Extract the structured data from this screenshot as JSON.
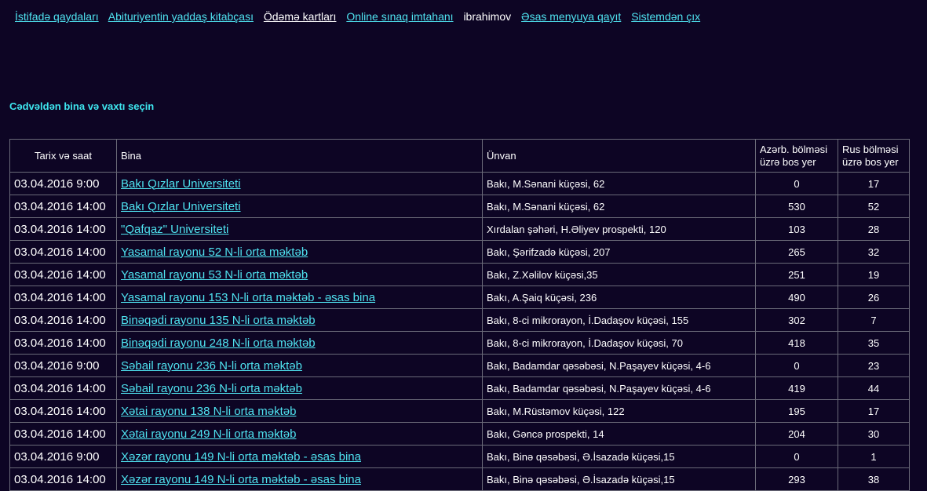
{
  "nav": {
    "items": [
      {
        "label": "İstifadə qaydaları",
        "style": "cyan"
      },
      {
        "label": "Abituriyentin yaddaş kitabçası",
        "style": "cyan"
      },
      {
        "label": "Ödəmə kartları",
        "style": "white"
      },
      {
        "label": "Online sınaq imtahanı",
        "style": "cyan"
      }
    ],
    "username": "ibrahimov",
    "main_menu": "Əsas menyuya qayıt",
    "logout": "Sistemdən çıx"
  },
  "heading": "Cədvəldən bina və vaxtı seçin",
  "table": {
    "headers": {
      "date": "Tarix və saat",
      "building": "Bina",
      "address": "Ünvan",
      "az_seats": "Azərb. bölməsi üzrə bos yer",
      "ru_seats": "Rus bölməsi üzrə bos yer"
    },
    "rows": [
      {
        "date": "03.04.2016 9:00",
        "building": "Bakı Qızlar Universiteti",
        "address": "Bakı, M.Sənani küçəsi, 62",
        "az": "0",
        "ru": "17"
      },
      {
        "date": "03.04.2016 14:00",
        "building": "Bakı Qızlar Universiteti",
        "address": "Bakı, M.Sənani küçəsi, 62",
        "az": "530",
        "ru": "52"
      },
      {
        "date": "03.04.2016 14:00",
        "building": "\"Qafqaz\" Universiteti",
        "address": "Xırdalan şəhəri, H.Əliyev prospekti, 120",
        "az": "103",
        "ru": "28"
      },
      {
        "date": "03.04.2016 14:00",
        "building": "Yasamal rayonu 52 N-li orta məktəb",
        "address": "Bakı, Şərifzadə küçəsi, 207",
        "az": "265",
        "ru": "32"
      },
      {
        "date": "03.04.2016 14:00",
        "building": "Yasamal rayonu 53 N-li orta məktəb",
        "address": "Bakı, Z.Xəlilov küçəsi,35",
        "az": "251",
        "ru": "19"
      },
      {
        "date": "03.04.2016 14:00",
        "building": "Yasamal rayonu 153 N-li orta məktəb - əsas bina",
        "address": "Bakı, A.Şaiq küçəsi, 236",
        "az": "490",
        "ru": "26"
      },
      {
        "date": "03.04.2016 14:00",
        "building": "Binəqədi rayonu 135 N-li orta məktəb",
        "address": "Bakı, 8-ci mikrorayon, İ.Dadaşov küçəsi, 155",
        "az": "302",
        "ru": "7"
      },
      {
        "date": "03.04.2016 14:00",
        "building": "Binəqədi rayonu 248 N-li orta məktəb",
        "address": "Bakı, 8-ci mikrorayon, İ.Dadaşov küçəsi, 70",
        "az": "418",
        "ru": "35"
      },
      {
        "date": "03.04.2016 9:00",
        "building": "Səbail rayonu 236 N-li orta məktəb",
        "address": "Bakı, Badamdar qəsəbəsi, N.Paşayev küçəsi, 4-6",
        "az": "0",
        "ru": "23"
      },
      {
        "date": "03.04.2016 14:00",
        "building": "Səbail rayonu 236 N-li orta məktəb",
        "address": "Bakı, Badamdar qəsəbəsi, N.Paşayev küçəsi, 4-6",
        "az": "419",
        "ru": "44"
      },
      {
        "date": "03.04.2016 14:00",
        "building": "Xətai rayonu 138 N-li orta məktəb",
        "address": "Bakı, M.Rüstəmov küçəsi, 122",
        "az": "195",
        "ru": "17"
      },
      {
        "date": "03.04.2016 14:00",
        "building": "Xətai rayonu 249 N-li orta məktəb",
        "address": "Bakı, Gəncə prospekti, 14",
        "az": "204",
        "ru": "30"
      },
      {
        "date": "03.04.2016 9:00",
        "building": "Xəzər rayonu 149 N-li orta məktəb - əsas bina",
        "address": "Bakı, Binə qəsəbəsi, Ə.İsazadə küçəsi,15",
        "az": "0",
        "ru": "1"
      },
      {
        "date": "03.04.2016 14:00",
        "building": "Xəzər rayonu 149 N-li orta məktəb - əsas bina",
        "address": "Bakı, Binə qəsəbəsi, Ə.İsazadə küçəsi,15",
        "az": "293",
        "ru": "38"
      }
    ]
  },
  "colors": {
    "background": "#0d0524",
    "link": "#4fe3f0",
    "heading": "#3ee6ef",
    "border": "#6a6a78"
  }
}
